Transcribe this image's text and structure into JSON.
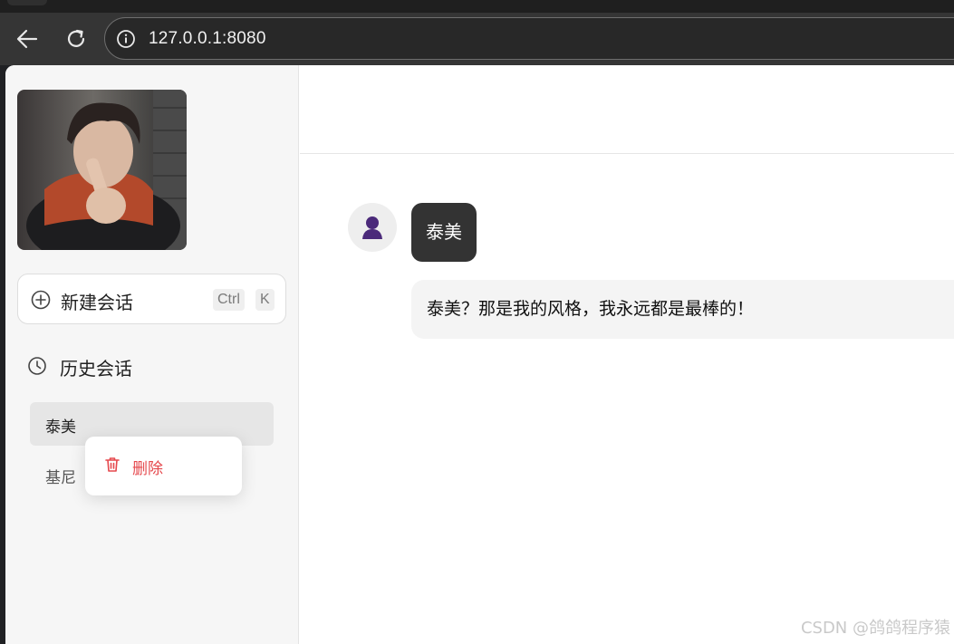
{
  "browser": {
    "url": "127.0.0.1:8080"
  },
  "sidebar": {
    "new_chat": {
      "label": "新建会话",
      "shortcut_ctrl": "Ctrl",
      "shortcut_key": "K"
    },
    "history": {
      "title": "历史会话",
      "items": [
        {
          "label": "泰美",
          "active": true
        },
        {
          "label": "基尼",
          "active": false
        }
      ]
    },
    "context_menu": {
      "delete_label": "删除"
    }
  },
  "chat": {
    "messages": [
      {
        "role": "user",
        "text": "泰美"
      },
      {
        "role": "assistant",
        "text": "泰美？那是我的风格，我永远都是最棒的！"
      }
    ]
  },
  "watermark": "CSDN @鸽鸽程序猿",
  "colors": {
    "accent_danger": "#e5484d",
    "user_bubble": "#333333",
    "avatar_icon": "#4b2a7a"
  }
}
